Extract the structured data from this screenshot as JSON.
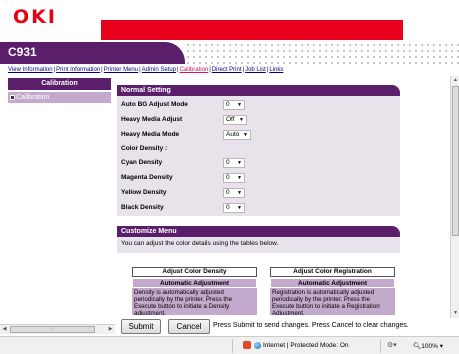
{
  "header": {
    "logo_text": "OKI",
    "model": "C931",
    "brand_red": "#e8001c",
    "brand_purple": "#5a1e6a"
  },
  "nav": {
    "links": [
      {
        "label": "View Information",
        "active": false
      },
      {
        "label": "Print Information",
        "active": false
      },
      {
        "label": "Printer Menu",
        "active": false
      },
      {
        "label": "Admin Setup",
        "active": false
      },
      {
        "label": "Calibration",
        "active": true
      },
      {
        "label": "Direct Print",
        "active": false
      },
      {
        "label": "Job List",
        "active": false
      },
      {
        "label": "Links",
        "active": false
      }
    ]
  },
  "sidebar": {
    "title": "Calibration",
    "items": [
      {
        "label": "Calibration"
      }
    ]
  },
  "normal_setting": {
    "title": "Normal Setting",
    "rows": [
      {
        "label": "Auto BG Adjust Mode",
        "value": "0"
      },
      {
        "label": "Heavy Media Adjust",
        "value": "Off"
      },
      {
        "label": "Heavy Media Mode",
        "value": "Auto"
      },
      {
        "label": "Color Density :",
        "value": null
      },
      {
        "label": "Cyan Density",
        "value": "0"
      },
      {
        "label": "Magenta Density",
        "value": "0"
      },
      {
        "label": "Yellow Density",
        "value": "0"
      },
      {
        "label": "Black Density",
        "value": "0"
      }
    ]
  },
  "customize_menu": {
    "title": "Customize Menu",
    "description": "You can adjust the color details using the tables below.",
    "tables": [
      {
        "title": "Adjust Color Density",
        "subtitle": "Automatic Adjustment",
        "text": "Density is automatically adjusted periodically by the printer. Press the Execute button to initiate a Density adjustment."
      },
      {
        "title": "Adjust Color Registration",
        "subtitle": "Automatic Adjustment",
        "text": "Registration is automatically adjusted periodically by the printer. Press the Execute button to initiate a Registration Adjustment."
      }
    ]
  },
  "actions": {
    "submit_label": "Submit",
    "cancel_label": "Cancel",
    "message": "Press Submit to send changes. Press Cancel to clear changes."
  },
  "statusbar": {
    "zone": "Internet | Protected Mode: On",
    "zoom": "100%"
  },
  "icons": {
    "dropdown": "chevron-down-icon",
    "scroll_up": "arrow-up-icon",
    "scroll_down": "arrow-down-icon"
  }
}
